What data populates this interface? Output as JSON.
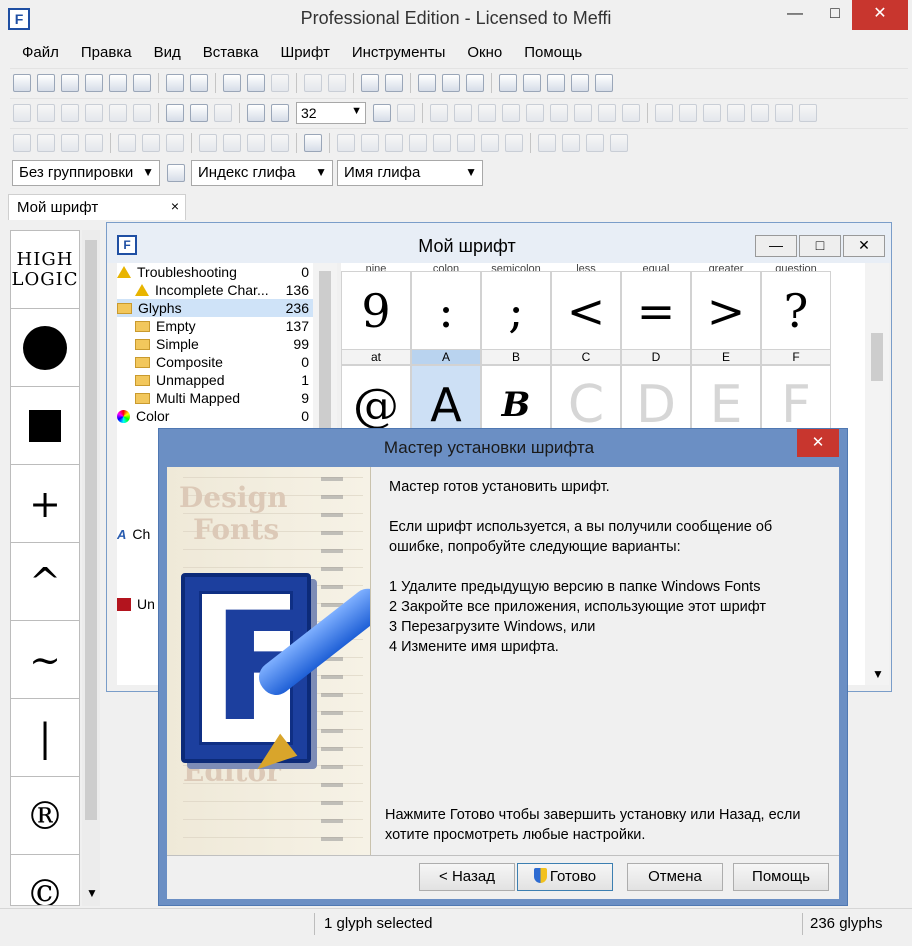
{
  "window": {
    "title": "Professional Edition - Licensed to Meffi",
    "minimize": "—",
    "maximize": "□",
    "close": "✕"
  },
  "menu": [
    "Файл",
    "Правка",
    "Вид",
    "Вставка",
    "Шрифт",
    "Инструменты",
    "Окно",
    "Помощь"
  ],
  "toolbar": {
    "zoom_value": "32"
  },
  "dropdowns": {
    "grouping": "Без группировки",
    "sort_index": "Индекс глифа",
    "name": "Имя глифа"
  },
  "doc_tab": {
    "label": "Мой шрифт",
    "close": "×"
  },
  "palette": {
    "logo": [
      "HIGH",
      "LOGIC"
    ],
    "glyphs": [
      "+",
      "^",
      "~",
      "|",
      "®",
      "©"
    ]
  },
  "font_window": {
    "title": "Мой шрифт",
    "tree": [
      {
        "label": "Troubleshooting",
        "count": "0",
        "icon": "warning-icon",
        "indent": 0
      },
      {
        "label": "Incomplete Char...",
        "count": "136",
        "icon": "warning-icon",
        "indent": 1
      },
      {
        "label": "Glyphs",
        "count": "236",
        "icon": "folder-icon",
        "indent": 0,
        "selected": true
      },
      {
        "label": "Empty",
        "count": "137",
        "icon": "folder-icon",
        "indent": 1
      },
      {
        "label": "Simple",
        "count": "99",
        "icon": "folder-icon",
        "indent": 1
      },
      {
        "label": "Composite",
        "count": "0",
        "icon": "folder-icon",
        "indent": 1
      },
      {
        "label": "Unmapped",
        "count": "1",
        "icon": "folder-icon",
        "indent": 1
      },
      {
        "label": "Multi Mapped",
        "count": "9",
        "icon": "folder-icon",
        "indent": 1
      },
      {
        "label": "Color",
        "count": "0",
        "icon": "color-icon",
        "indent": 0
      },
      {
        "label": "Ch",
        "count": "",
        "icon": "font-icon",
        "indent": 0
      },
      {
        "label": "Un",
        "count": "",
        "icon": "unicode-icon",
        "indent": 0
      }
    ],
    "grid": {
      "row1_headers": [
        "nine",
        "colon",
        "semicolon",
        "less",
        "equal",
        "greater",
        "question"
      ],
      "row1_glyphs": [
        "9",
        ":",
        ";",
        "<",
        "=",
        ">",
        "?"
      ],
      "row2_labels": [
        "at",
        "A",
        "B",
        "C",
        "D",
        "E",
        "F"
      ],
      "row2_glyphs": [
        "@",
        "A",
        "B",
        "C",
        "D",
        "E",
        "F"
      ]
    }
  },
  "wizard": {
    "title": "Мастер установки шрифта",
    "close": "✕",
    "art_words": [
      "Design",
      "Fonts",
      "Editor"
    ],
    "intro": "Мастер готов установить шрифт.",
    "error_text": "Если шрифт используется, а вы получили сообщение об ошибке, попробуйте следующие варианты:",
    "steps": [
      "1 Удалите предыдущую версию в папке Windows Fonts",
      "2 Закройте все приложения, использующие этот шрифт",
      "3 Перезагрузите Windows, или",
      "4 Измените имя шрифта."
    ],
    "footer": "Нажмите Готово чтобы завершить установку или Назад, если хотите просмотреть любые настройки.",
    "buttons": {
      "back": "< Назад",
      "finish": "Готово",
      "cancel": "Отмена",
      "help": "Помощь"
    }
  },
  "status": {
    "selection": "1 glyph selected",
    "count": "236 glyphs"
  }
}
